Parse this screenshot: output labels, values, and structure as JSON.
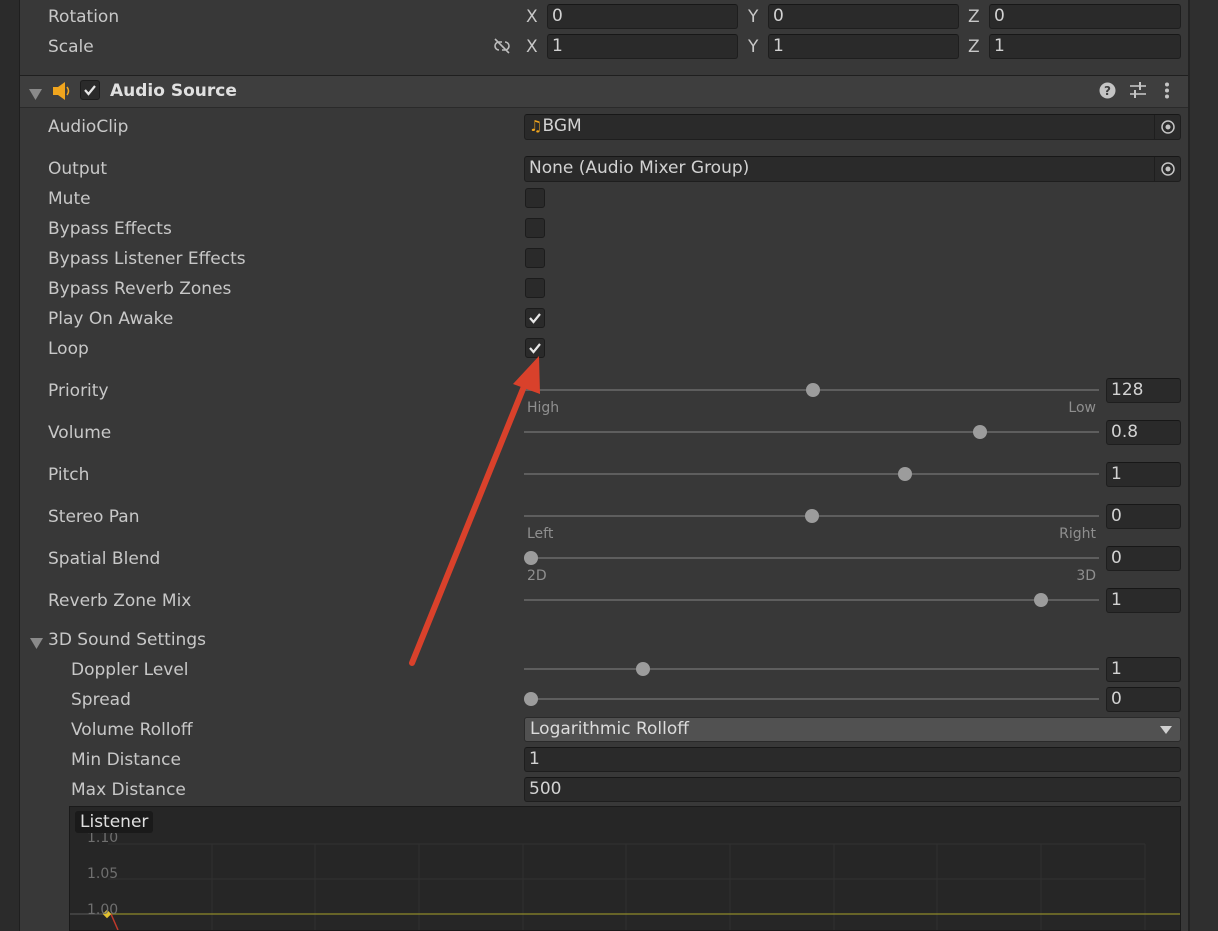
{
  "transform": {
    "rotation": {
      "label": "Rotation",
      "x_label": "X",
      "x": "0",
      "y_label": "Y",
      "y": "0",
      "z_label": "Z",
      "z": "0"
    },
    "scale": {
      "label": "Scale",
      "x_label": "X",
      "x": "1",
      "y_label": "Y",
      "y": "1",
      "z_label": "Z",
      "z": "1"
    }
  },
  "component": {
    "title": "Audio Source",
    "enabled": true
  },
  "props": {
    "audioclip": {
      "label": "AudioClip",
      "value": "BGM"
    },
    "output": {
      "label": "Output",
      "value": "None (Audio Mixer Group)"
    },
    "mute": {
      "label": "Mute",
      "checked": false
    },
    "bypass_effects": {
      "label": "Bypass Effects",
      "checked": false
    },
    "bypass_listener": {
      "label": "Bypass Listener Effects",
      "checked": false
    },
    "bypass_reverb": {
      "label": "Bypass Reverb Zones",
      "checked": false
    },
    "play_on_awake": {
      "label": "Play On Awake",
      "checked": true
    },
    "loop": {
      "label": "Loop",
      "checked": true
    }
  },
  "sliders": {
    "priority": {
      "label": "Priority",
      "value": "128",
      "fraction": 0.502,
      "min_label": "High",
      "max_label": "Low"
    },
    "volume": {
      "label": "Volume",
      "value": "0.8",
      "fraction": 0.8
    },
    "pitch": {
      "label": "Pitch",
      "value": "1",
      "fraction": 0.667
    },
    "stereo_pan": {
      "label": "Stereo Pan",
      "value": "0",
      "fraction": 0.5,
      "min_label": "Left",
      "max_label": "Right"
    },
    "spatial_blend": {
      "label": "Spatial Blend",
      "value": "0",
      "fraction": 0.0,
      "min_label": "2D",
      "max_label": "3D"
    },
    "reverb_zone_mix": {
      "label": "Reverb Zone Mix",
      "value": "1",
      "fraction": 0.909
    }
  },
  "sound3d": {
    "title": "3D Sound Settings",
    "doppler": {
      "label": "Doppler Level",
      "value": "1",
      "fraction": 0.2
    },
    "spread": {
      "label": "Spread",
      "value": "0",
      "fraction": 0.0
    },
    "rolloff": {
      "label": "Volume Rolloff",
      "value": "Logarithmic Rolloff"
    },
    "min_distance": {
      "label": "Min Distance",
      "value": "1"
    },
    "max_distance": {
      "label": "Max Distance",
      "value": "500"
    }
  },
  "graph": {
    "tag": "Listener",
    "y_ticks": [
      "1.10",
      "1.05",
      "1.00"
    ]
  },
  "colors": {
    "accent_arrow": "#d9412b",
    "audio_icon": "#f0a51e",
    "background": "#383838"
  },
  "icons": [
    "audio-source-icon",
    "help-icon",
    "presets-icon",
    "kebab-menu-icon",
    "object-picker-icon",
    "unlink-scale-icon"
  ]
}
